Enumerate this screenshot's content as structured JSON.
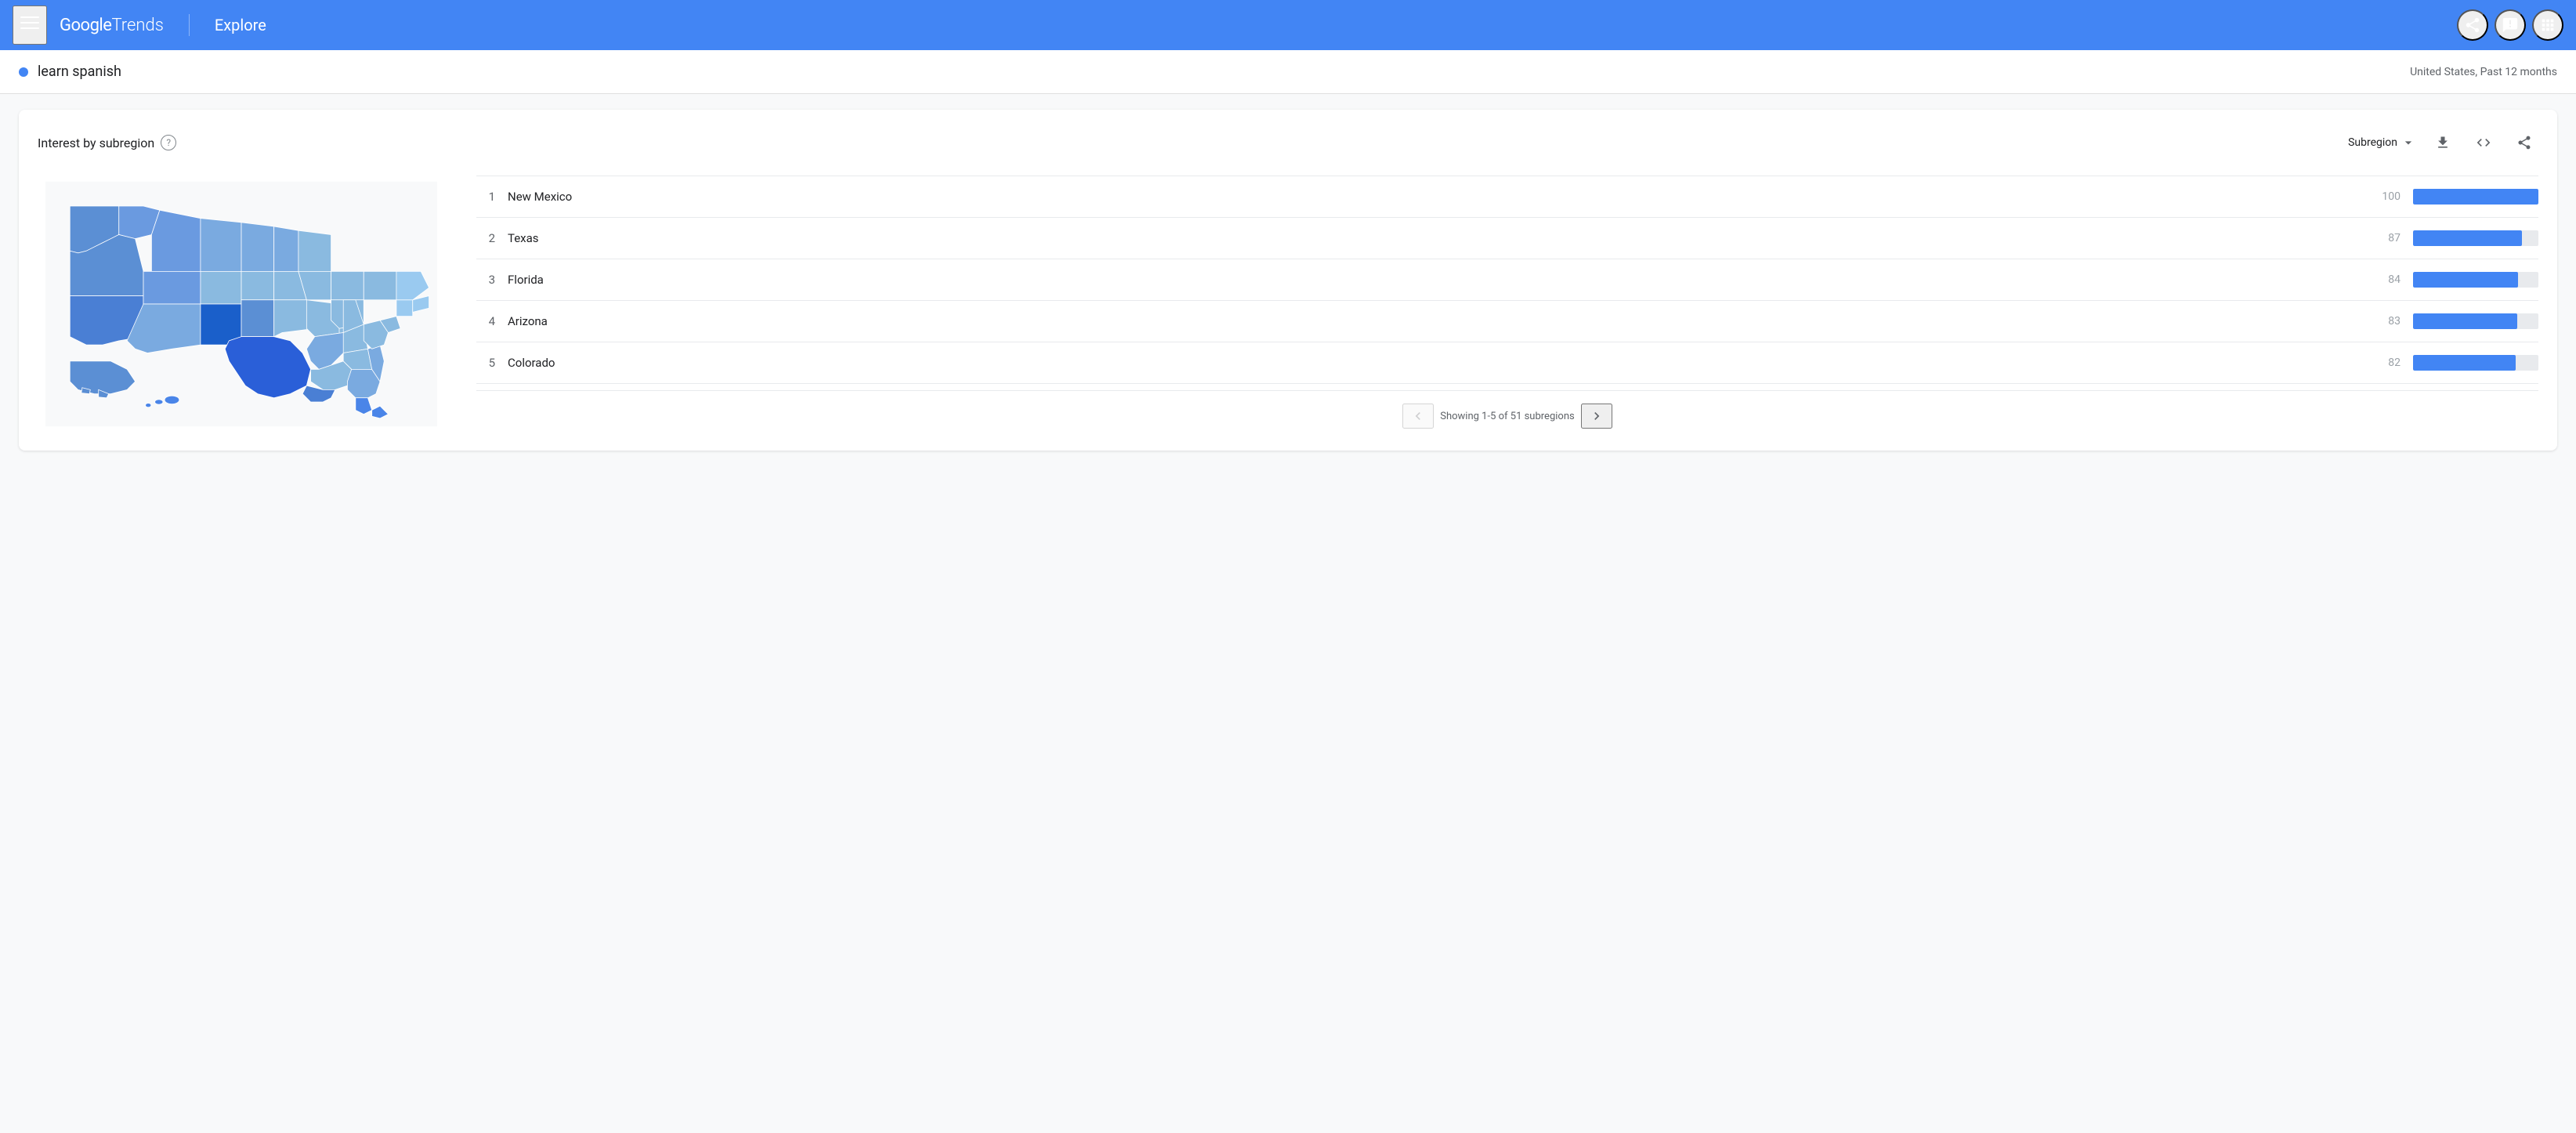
{
  "header": {
    "menu_label": "☰",
    "logo_google": "Google",
    "logo_trends": "Trends",
    "explore_label": "Explore",
    "share_icon": "share",
    "feedback_icon": "feedback",
    "apps_icon": "apps"
  },
  "search_bar": {
    "term": "learn spanish",
    "meta": "United States, Past 12 months"
  },
  "card": {
    "title": "Interest by subregion",
    "help_label": "?",
    "controls": {
      "dropdown_label": "Subregion",
      "download_icon": "download",
      "embed_icon": "embed",
      "share_icon": "share"
    },
    "pagination": {
      "label": "Showing 1-5 of 51 subregions",
      "prev_icon": "‹",
      "next_icon": "›"
    },
    "rankings": [
      {
        "rank": 1,
        "name": "New Mexico",
        "score": 100,
        "bar_pct": 100
      },
      {
        "rank": 2,
        "name": "Texas",
        "score": 87,
        "bar_pct": 87
      },
      {
        "rank": 3,
        "name": "Florida",
        "score": 84,
        "bar_pct": 84
      },
      {
        "rank": 4,
        "name": "Arizona",
        "score": 83,
        "bar_pct": 83
      },
      {
        "rank": 5,
        "name": "Colorado",
        "score": 82,
        "bar_pct": 82
      }
    ]
  },
  "colors": {
    "header_bg": "#4285f4",
    "bar_fill": "#4285f4",
    "dot_blue": "#4285f4"
  }
}
